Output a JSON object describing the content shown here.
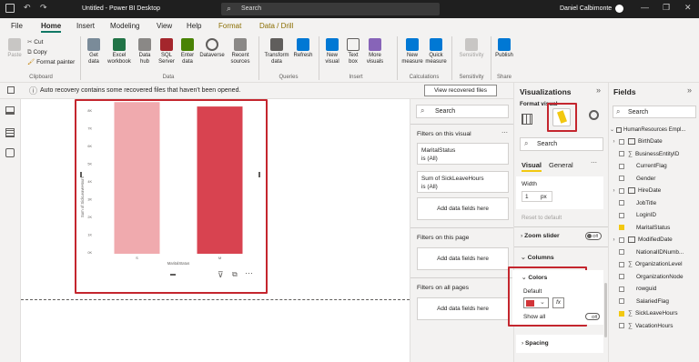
{
  "titlebar": {
    "title": "Untitled - Power BI Desktop",
    "search_placeholder": "Search",
    "user": "Daniel Calbimonte"
  },
  "menu": {
    "tabs": [
      "File",
      "Home",
      "Insert",
      "Modeling",
      "View",
      "Help",
      "Format",
      "Data / Drill"
    ]
  },
  "ribbon": {
    "clipboard": {
      "paste": "Paste",
      "cut": "Cut",
      "copy": "Copy",
      "format_painter": "Format painter",
      "group": "Clipboard"
    },
    "data": {
      "items": [
        "Get data",
        "Excel workbook",
        "Data hub",
        "SQL Server",
        "Enter data",
        "Dataverse",
        "Recent sources"
      ],
      "group": "Data"
    },
    "queries": {
      "items": [
        "Transform data",
        "Refresh"
      ],
      "group": "Queries"
    },
    "insert": {
      "items": [
        "New visual",
        "Text box",
        "More visuals"
      ],
      "group": "Insert"
    },
    "calculations": {
      "items": [
        "New measure",
        "Quick measure"
      ],
      "group": "Calculations"
    },
    "sensitivity": {
      "items": [
        "Sensitivity"
      ],
      "group": "Sensitivity"
    },
    "share": {
      "items": [
        "Publish"
      ],
      "group": "Share"
    }
  },
  "notification": {
    "text": "Auto recovery contains some recovered files that haven't been opened.",
    "button": "View recovered files"
  },
  "chart_data": {
    "type": "bar",
    "categories": [
      "S",
      "M"
    ],
    "values": [
      10.3,
      10.0
    ],
    "xlabel": "MaritalStatus",
    "ylabel": "Sum of SickLeaveHours",
    "colors": [
      "#f0aaae",
      "#d84350"
    ],
    "yticks": [
      "8K",
      "7K",
      "6K",
      "5K",
      "4K",
      "3K",
      "2K",
      "1K",
      "0K"
    ]
  },
  "filters": {
    "search": "Search",
    "on_visual_title": "Filters on this visual",
    "visual_filters": [
      {
        "name": "MaritalStatus",
        "value": "is (All)"
      },
      {
        "name": "Sum of SickLeaveHours",
        "value": "is (All)"
      }
    ],
    "add": "Add data fields here",
    "on_page_title": "Filters on this page",
    "on_all_title": "Filters on all pages"
  },
  "viz": {
    "title": "Visualizations",
    "format_visual": "Format visual",
    "search": "Search",
    "tab_visual": "Visual",
    "tab_general": "General",
    "width_label": "Width",
    "width_value": "1",
    "width_unit": "px",
    "reset": "Reset to default",
    "zoom_slider": "Zoom slider",
    "zoom_state": "Off",
    "columns": "Columns",
    "colors_title": "Colors",
    "default_label": "Default",
    "default_color": "#d13438",
    "fx": "fx",
    "show_all": "Show all",
    "show_all_state": "Off",
    "spacing": "Spacing"
  },
  "fields": {
    "title": "Fields",
    "search": "Search",
    "table": "HumanResources Empl...",
    "items": [
      {
        "name": "BirthDate",
        "type": "table",
        "checked": false,
        "expand": true
      },
      {
        "name": "BusinessEntityID",
        "type": "sigma",
        "checked": false,
        "expand": false
      },
      {
        "name": "CurrentFlag",
        "type": "none",
        "checked": false,
        "expand": false
      },
      {
        "name": "Gender",
        "type": "none",
        "checked": false,
        "expand": false
      },
      {
        "name": "HireDate",
        "type": "table",
        "checked": false,
        "expand": true
      },
      {
        "name": "JobTitle",
        "type": "none",
        "checked": false,
        "expand": false
      },
      {
        "name": "LoginID",
        "type": "none",
        "checked": false,
        "expand": false
      },
      {
        "name": "MaritalStatus",
        "type": "none",
        "checked": true,
        "expand": false
      },
      {
        "name": "ModifiedDate",
        "type": "table",
        "checked": false,
        "expand": true
      },
      {
        "name": "NationalIDNumb...",
        "type": "none",
        "checked": false,
        "expand": false
      },
      {
        "name": "OrganizationLevel",
        "type": "sigma",
        "checked": false,
        "expand": false
      },
      {
        "name": "OrganizationNode",
        "type": "none",
        "checked": false,
        "expand": false
      },
      {
        "name": "rowguid",
        "type": "none",
        "checked": false,
        "expand": false
      },
      {
        "name": "SalariedFlag",
        "type": "none",
        "checked": false,
        "expand": false
      },
      {
        "name": "SickLeaveHours",
        "type": "sigma",
        "checked": true,
        "expand": false
      },
      {
        "name": "VacationHours",
        "type": "sigma",
        "checked": false,
        "expand": false
      }
    ]
  }
}
